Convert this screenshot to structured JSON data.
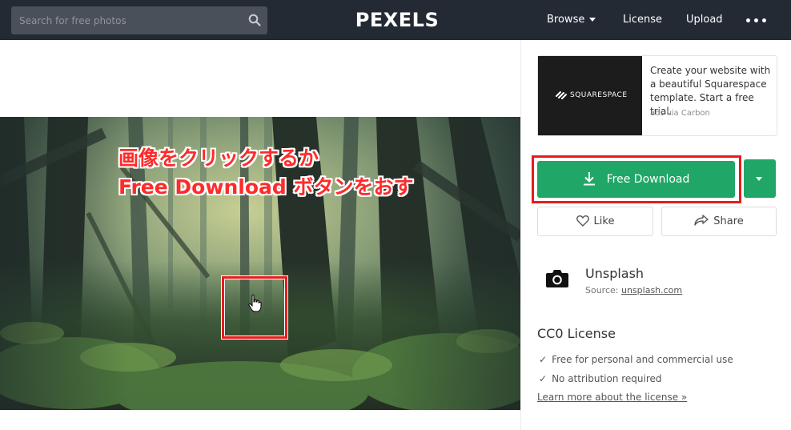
{
  "header": {
    "search_placeholder": "Search for free photos",
    "logo_text": "PEXELS",
    "nav": {
      "browse_label": "Browse",
      "license_label": "License",
      "upload_label": "Upload"
    }
  },
  "annotation": {
    "line1": "画像をクリックするか",
    "line2": "Free  Download ボタンをおす"
  },
  "ad": {
    "brand": "SQUARESPACE",
    "text": "Create your website with a beautiful Squarespace template. Start a free trial.",
    "via": "ads via Carbon"
  },
  "download": {
    "label": "Free Download"
  },
  "actions": {
    "like_label": "Like",
    "share_label": "Share"
  },
  "photographer": {
    "name": "Unsplash",
    "source_prefix": "Source: ",
    "source_link": "unsplash.com"
  },
  "license": {
    "title": "CC0 License",
    "items": [
      "Free for personal and commercial use",
      "No attribution required"
    ],
    "check_glyph": "✓",
    "learn_more": "Learn more about the license »"
  },
  "colors": {
    "topbar": "#232a34",
    "accent_green": "#20a767",
    "annotation_red": "#e61c1c"
  }
}
